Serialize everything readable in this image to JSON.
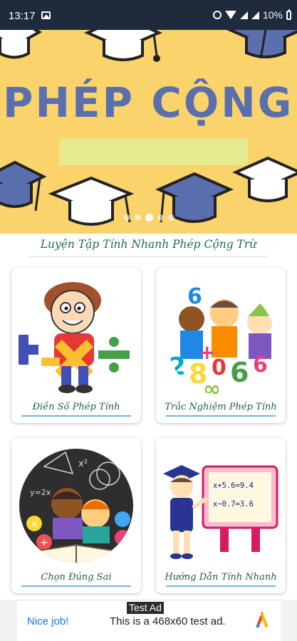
{
  "status_bar": {
    "time": "13:17",
    "battery": "10%",
    "icons": [
      "gallery-icon",
      "alarm-icon",
      "wifi-icon",
      "signal-icon",
      "signal-icon",
      "battery-icon"
    ]
  },
  "banner": {
    "title": "PHÉP CỘNG",
    "carousel_pages": 5,
    "active_page": 3,
    "colors": {
      "background": "#fad46a",
      "title": "#5a6fae",
      "box": "#e6ea8e"
    }
  },
  "subtitle": "Luyện Tập Tính Nhanh Phép Cộng Trừ",
  "cards": [
    {
      "label": "Điền Số Phép Tính",
      "icon": "math-operators-boy-illustration"
    },
    {
      "label": "Trắc Nghiệm Phép Tính",
      "icon": "kids-with-numbers-illustration"
    },
    {
      "label": "Chọn Đúng Sai",
      "icon": "kids-reading-chalkboard-illustration"
    },
    {
      "label": "Hướng Dẫn Tính Nhanh",
      "icon": "graduate-with-board-illustration"
    }
  ],
  "board": {
    "line1": "x+5.6=9.4",
    "line2": "x−0.7=3.6"
  },
  "ad": {
    "tag": "Test Ad",
    "headline": "Nice job!",
    "body": "This is a 468x60 test ad.",
    "icon": "adchoices-logo"
  },
  "accent_color": "#1d6a52"
}
